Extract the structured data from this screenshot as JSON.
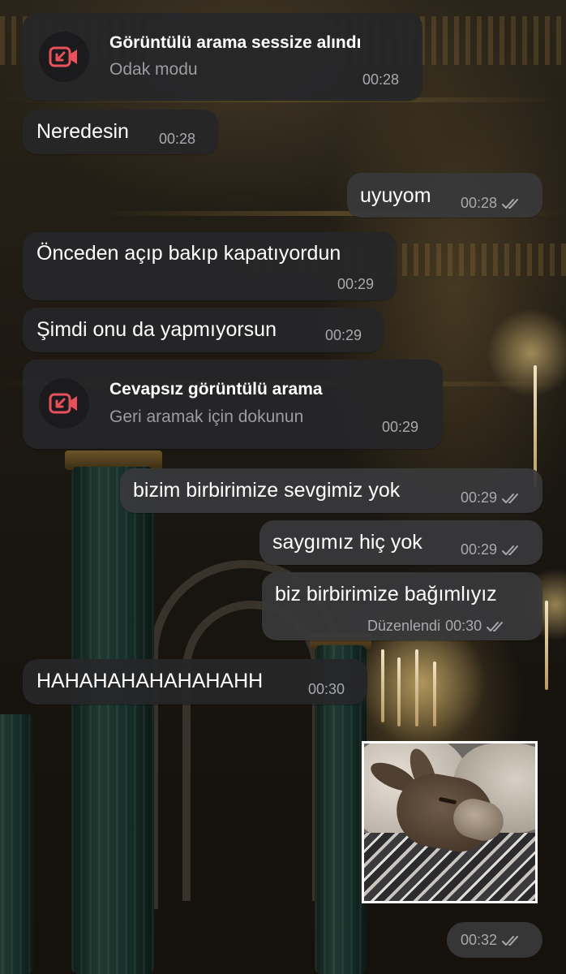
{
  "calls": [
    {
      "title": "Görüntülü arama sessize alındı",
      "subtitle": "Odak modu",
      "time": "00:28",
      "icon": "missed-video-call-icon",
      "icon_color": "#e8505b"
    },
    {
      "title": "Cevapsız görüntülü arama",
      "subtitle": "Geri aramak için dokunun",
      "time": "00:29",
      "icon": "missed-video-call-icon",
      "icon_color": "#e8505b"
    }
  ],
  "messages": [
    {
      "text": "Neredesin",
      "time": "00:28",
      "direction": "in"
    },
    {
      "text": "uyuyom",
      "time": "00:28",
      "direction": "out",
      "status": "read"
    },
    {
      "text": "Önceden açıp bakıp kapatıyordun",
      "time": "00:29",
      "direction": "in"
    },
    {
      "text": "Şimdi onu da yapmıyorsun",
      "time": "00:29",
      "direction": "in"
    },
    {
      "text": "bizim birbirimize sevgimiz yok",
      "time": "00:29",
      "direction": "out",
      "status": "read"
    },
    {
      "text": "saygımız hiç yok",
      "time": "00:29",
      "direction": "out",
      "status": "read"
    },
    {
      "text": "biz birbirimize bağımlıyız",
      "time": "00:30",
      "direction": "out",
      "status": "read",
      "edited_label": "Düzenlendi"
    },
    {
      "text": "HAHAHAHAHAHAHAHH",
      "time": "00:30",
      "direction": "in"
    }
  ],
  "photo_message": {
    "time": "00:32",
    "direction": "out",
    "status": "read"
  },
  "colors": {
    "bubble_in": "#262628",
    "bubble_out": "#38383a",
    "meta_text": "#a9a9ae",
    "accent_red": "#e8505b"
  }
}
